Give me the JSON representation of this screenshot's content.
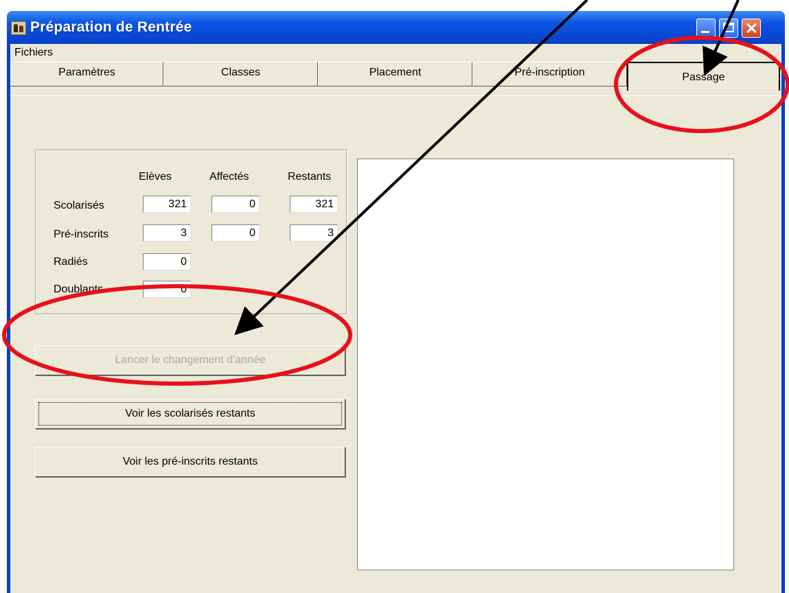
{
  "window": {
    "title": "Préparation de Rentrée"
  },
  "menu": {
    "fichiers": "Fichiers"
  },
  "tabs": [
    {
      "label": "Paramètres"
    },
    {
      "label": "Classes"
    },
    {
      "label": "Placement"
    },
    {
      "label": "Pré-inscription"
    },
    {
      "label": "Passage",
      "active": true
    }
  ],
  "stats": {
    "headers": {
      "eleves": "Elèves",
      "affectes": "Affectés",
      "restants": "Restants"
    },
    "rows": [
      {
        "label": "Scolarisés",
        "eleves": "321",
        "affectes": "0",
        "restants": "321"
      },
      {
        "label": "Pré-inscrits",
        "eleves": "3",
        "affectes": "0",
        "restants": "3"
      },
      {
        "label": "Radiés",
        "eleves": "0"
      },
      {
        "label": "Doublants",
        "eleves": "0"
      }
    ]
  },
  "buttons": {
    "lancer": "Lancer le changement d'année",
    "voir_scolarises": "Voir les scolarisés restants",
    "voir_preinscrits": "Voir les pré-inscrits restants"
  },
  "colors": {
    "annotation_ellipse": "#e8101a",
    "annotation_arrow": "#000000"
  }
}
